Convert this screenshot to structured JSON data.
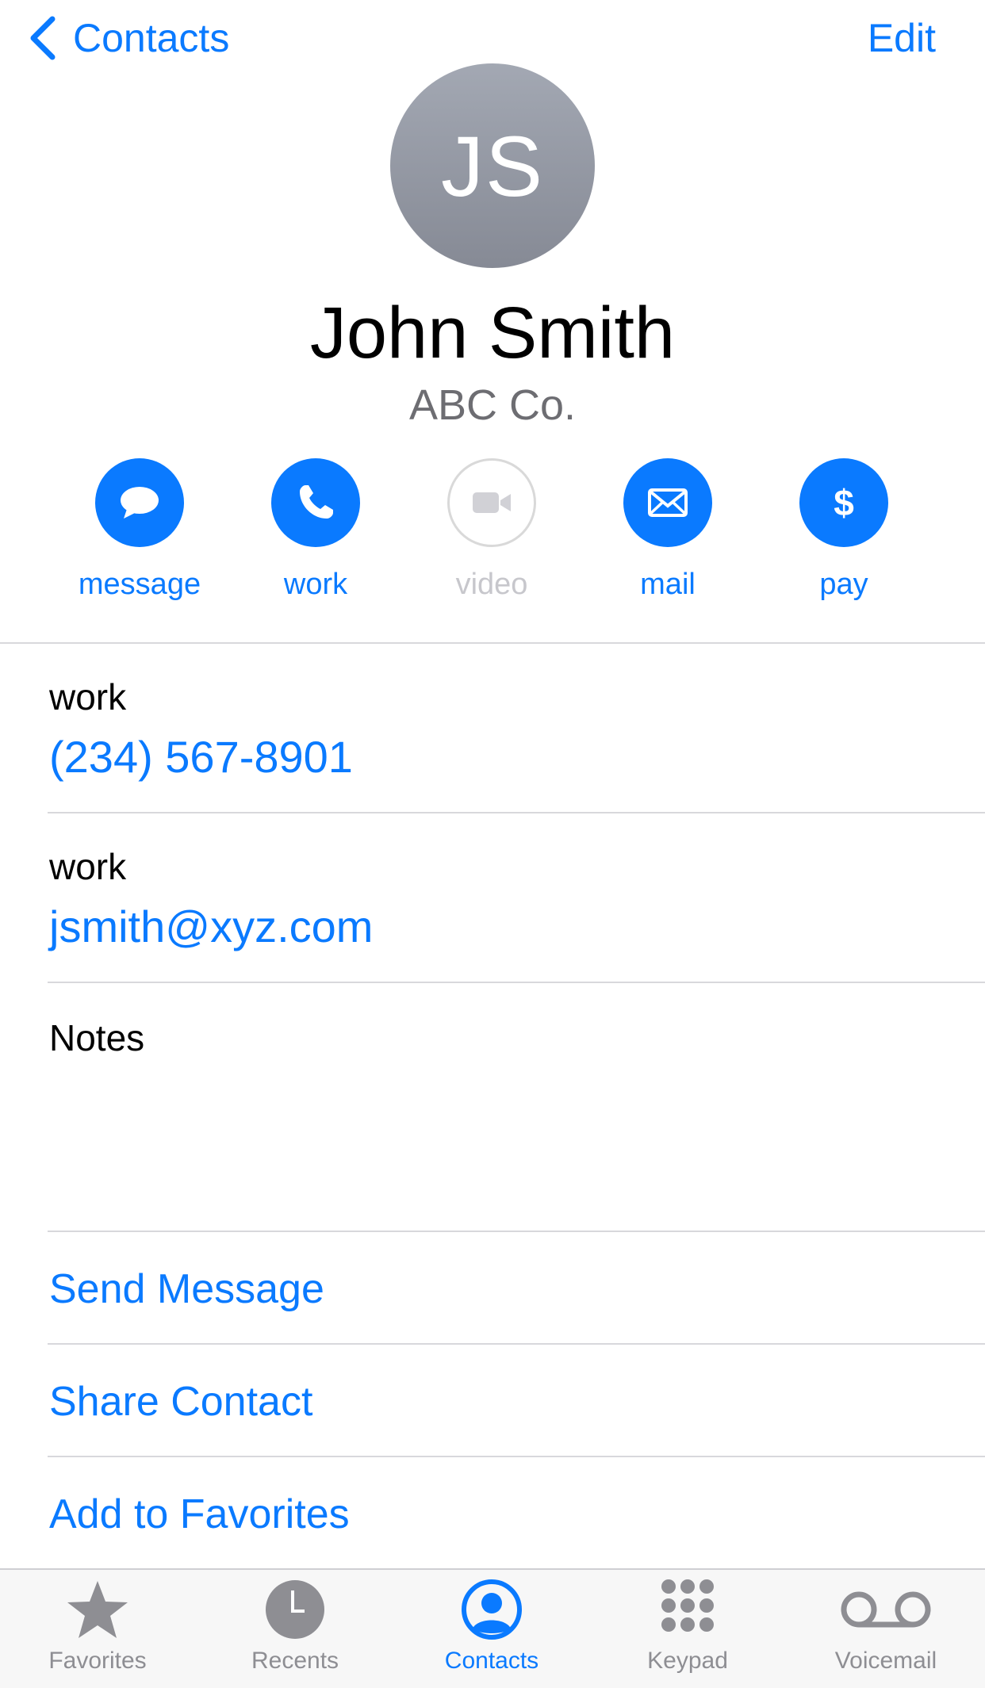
{
  "nav": {
    "back_label": "Contacts",
    "edit_label": "Edit"
  },
  "contact": {
    "initials": "JS",
    "name": "John Smith",
    "company": "ABC Co."
  },
  "actions": [
    {
      "label": "message",
      "icon": "message-bubble-icon",
      "enabled": true
    },
    {
      "label": "work",
      "icon": "phone-icon",
      "enabled": true
    },
    {
      "label": "video",
      "icon": "video-camera-icon",
      "enabled": false
    },
    {
      "label": "mail",
      "icon": "envelope-icon",
      "enabled": true
    },
    {
      "label": "pay",
      "icon": "dollar-icon",
      "enabled": true
    }
  ],
  "fields": {
    "phone": {
      "label": "work",
      "value": "(234) 567-8901"
    },
    "email": {
      "label": "work",
      "value": "jsmith@xyz.com"
    },
    "notes": {
      "label": "Notes",
      "value": ""
    }
  },
  "links": {
    "send_message": "Send Message",
    "share_contact": "Share Contact",
    "add_favorites": "Add to Favorites"
  },
  "tabs": [
    {
      "label": "Favorites",
      "icon": "star-icon",
      "active": false
    },
    {
      "label": "Recents",
      "icon": "clock-icon",
      "active": false
    },
    {
      "label": "Contacts",
      "icon": "person-circle-icon",
      "active": true
    },
    {
      "label": "Keypad",
      "icon": "keypad-icon",
      "active": false
    },
    {
      "label": "Voicemail",
      "icon": "voicemail-icon",
      "active": false
    }
  ],
  "colors": {
    "accent": "#0a7aff",
    "disabled": "#c7c7cc",
    "secondary_text": "#6d6d72",
    "tab_inactive": "#8e8e93"
  }
}
